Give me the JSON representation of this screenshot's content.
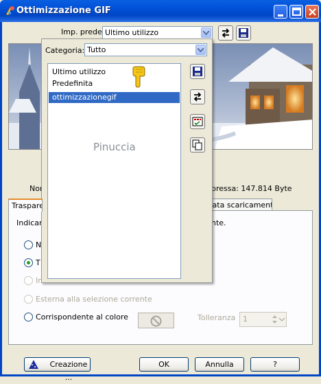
{
  "window": {
    "title": "Ottimizzazione GIF"
  },
  "preset": {
    "label": "Imp. predef.:",
    "value": "Ultimo utilizzo"
  },
  "size_info": {
    "left_fragment": "Nor",
    "right_fragment": "pressa: 147.814 Byte"
  },
  "tabs": [
    {
      "label": "Traspare"
    },
    {
      "label": "rata scaricamento"
    }
  ],
  "panel": {
    "instruction_left": "Indicare",
    "instruction_right": "nte.",
    "options": [
      {
        "label": "N",
        "checked": false,
        "disabled": false
      },
      {
        "label": "T",
        "checked": true,
        "disabled": false
      },
      {
        "label": "In",
        "checked": false,
        "disabled": true
      },
      {
        "label": "Esterna alla selezione corrente",
        "checked": false,
        "disabled": true
      },
      {
        "label": "Corrispondente al colore",
        "checked": false,
        "disabled": false
      }
    ],
    "tolerance_label": "Tolleranza",
    "tolerance_value": "1"
  },
  "popup": {
    "category_label": "Categoria:",
    "category_value": "Tutto",
    "items": [
      {
        "label": "Ultimo utilizzo",
        "selected": false
      },
      {
        "label": "Predefinita",
        "selected": false
      },
      {
        "label": "ottimizzazionegif",
        "selected": true
      }
    ],
    "watermark": "Pinuccia"
  },
  "buttons": {
    "creation": "Creazione ...",
    "ok": "OK",
    "cancel": "Annulla",
    "help": "?"
  },
  "colors": {
    "titlebar": "#0054e3",
    "selection": "#316ac5",
    "dialog_bg": "#ece9d8",
    "pointer_hand": "#f5c518"
  }
}
